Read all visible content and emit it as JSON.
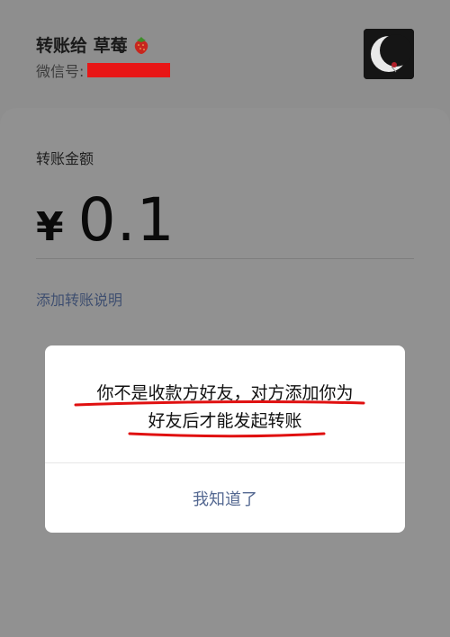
{
  "header": {
    "recipient_title": "转账给 草莓",
    "wechat_id_label": "微信号:"
  },
  "transfer": {
    "amount_label": "转账金额",
    "currency_symbol": "¥",
    "amount": "0.1",
    "add_note_link": "添加转账说明"
  },
  "dialog": {
    "message_line1": "你不是收款方好友，对方添加你为",
    "message_line2": "好友后才能发起转账",
    "ok_button": "我知道了"
  },
  "colors": {
    "underline": "#e01010",
    "redaction": "#e81616",
    "link": "#546891"
  }
}
